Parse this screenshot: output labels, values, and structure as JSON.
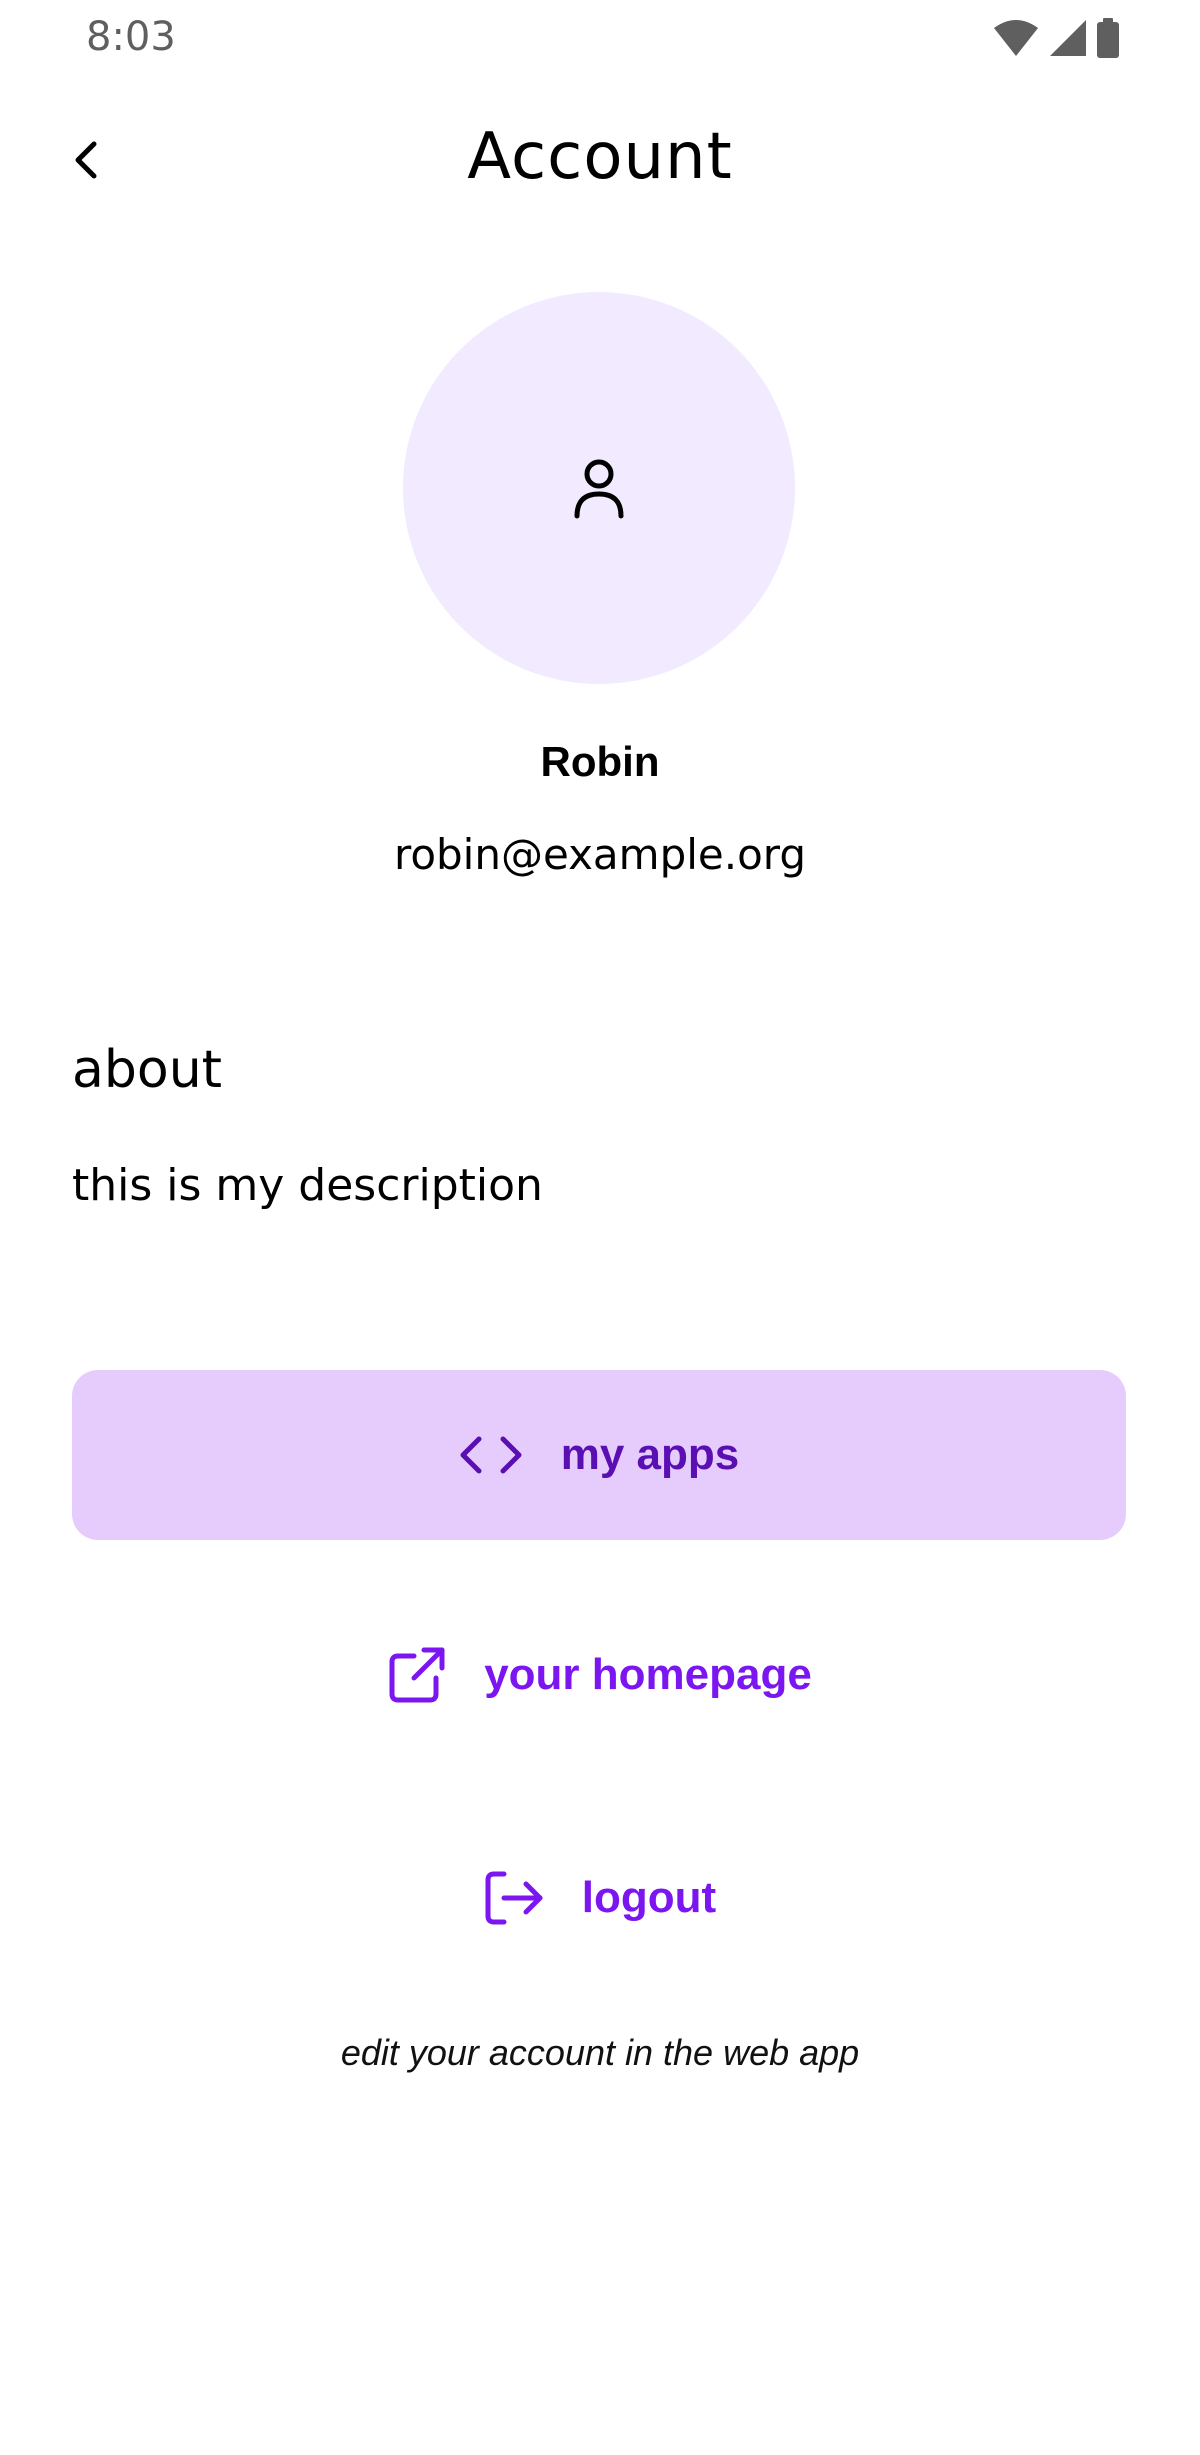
{
  "status_bar": {
    "time": "8:03",
    "icons": [
      "wifi-icon",
      "cell-signal-icon",
      "battery-icon"
    ]
  },
  "app_bar": {
    "back_icon": "chevron-left-icon",
    "title": "Account"
  },
  "profile": {
    "avatar_icon": "user-icon",
    "name": "Robin",
    "email": "robin@example.org"
  },
  "about": {
    "heading": "about",
    "text": "this is my description"
  },
  "actions": {
    "my_apps": {
      "label": "my apps",
      "icon": "code-icon"
    },
    "homepage": {
      "label": "your homepage",
      "icon": "external-link-icon"
    },
    "logout": {
      "label": "logout",
      "icon": "logout-icon"
    }
  },
  "footer": {
    "note": "edit your account in the web app"
  },
  "colors": {
    "avatar_bg": "#f2eafe",
    "primary_button_bg": "#e5ccfd",
    "primary_button_text": "#5a0fb3",
    "link_text": "#7b16f0"
  }
}
